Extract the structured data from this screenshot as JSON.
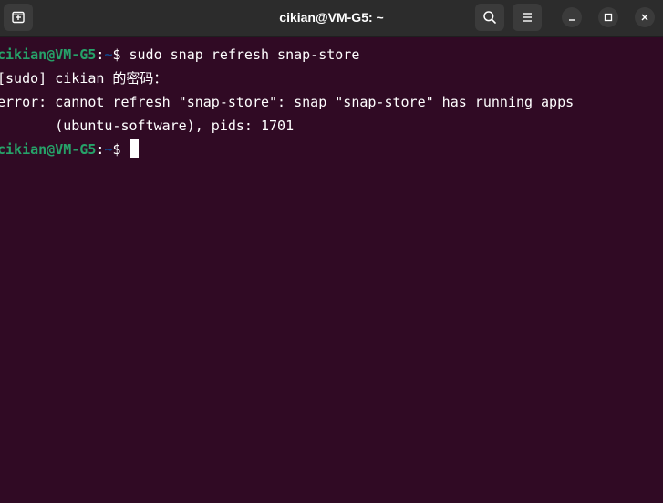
{
  "window": {
    "title": "cikian@VM-G5: ~"
  },
  "titlebar": {
    "icons": {
      "new_tab": "new-tab-icon",
      "search": "search-icon",
      "menu": "hamburger-menu-icon",
      "minimize": "minimize-icon",
      "maximize": "maximize-icon",
      "close": "close-icon"
    }
  },
  "colors": {
    "terminal_background": "#300a24",
    "titlebar_background": "#2c2c2c",
    "prompt_user": "#26a269",
    "prompt_path": "#12488b",
    "text": "#ffffff"
  },
  "terminal": {
    "prompt1": {
      "user_host": "cikian@VM-G5",
      "colon": ":",
      "path": "~",
      "symbol": "$",
      "command": " sudo snap refresh snap-store"
    },
    "sudo_prompt": "[sudo] cikian 的密码：",
    "error_line1": "error: cannot refresh \"snap-store\": snap \"snap-store\" has running apps",
    "error_line2": "       (ubuntu-software), pids: 1701",
    "prompt2": {
      "user_host": "cikian@VM-G5",
      "colon": ":",
      "path": "~",
      "symbol": "$",
      "command": " "
    }
  }
}
